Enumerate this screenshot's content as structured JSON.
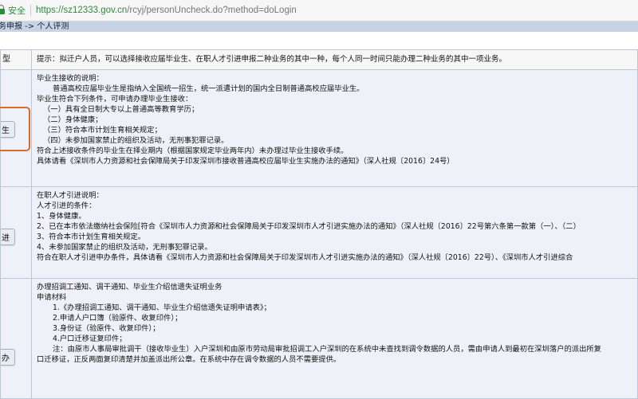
{
  "browser": {
    "secure_label": "安全",
    "url_host": "https://sz12333.gov.cn",
    "url_path": "/rcyj/personUncheck.do?method=doLogin"
  },
  "breadcrumb": "务申报 -> 个人评测",
  "header": {
    "type_label": "型",
    "tip": "提示：拟迁户人员，可以选择接收应届毕业生、在职人才引进申报二种业务的其中一种，每个人同一时间只能办理二种业务的其中一项业务。"
  },
  "rows": [
    {
      "button_label": "生",
      "lines": [
        "毕业生接收的说明：",
        "普通高校应届毕业生是指纳入全国统一招生，统一派遣计划的国内全日制普通高校应届毕业生。",
        "毕业生符合下列条件，可申请办理毕业生接收：",
        "（一）具有全日制大专以上普通高等教育学历；",
        "（二）身体健康；",
        "（三）符合本市计划生育相关规定；",
        "（四）未参加国家禁止的组织及活动，无刑事犯罪记录。",
        "符合上述接收条件的毕业生在择业期内（根据国家规定毕业两年内）未办理过毕业生接收手续。",
        "具体请看《深圳市人力资源和社会保障局关于印发深圳市接收普通高校应届毕业生实施办法的通知》（深人社规〔2016〕24号）"
      ]
    },
    {
      "button_label": "进",
      "lines": [
        "在职人才引进说明：",
        "人才引进的条件：",
        "1、身体健康。",
        "2、已在本市依法缴纳社会保险[符合《深圳市人力资源和社会保障局关于印发深圳市人才引进实施办法的通知》（深人社规〔2016〕22号第六条第一款第（一）、（二）",
        "3、符合本市计划生育相关规定。",
        "4、未参加国家禁止的组织及活动，无刑事犯罪记录。",
        "符合在职人才引进申办条件，具体请看《深圳市人力资源和社会保障局关于印发深圳市人才引进实施办法的通知》（深人社规〔2016〕22号）、《深圳市人才引进综合"
      ]
    },
    {
      "button_label": "办",
      "lines": [
        "办理招调工通知、调干通知、毕业生介绍信遗失证明业务",
        "申请材料",
        "1.《办理招调工通知、调干通知、毕业生介绍信遗失证明申请表》；",
        "2.申请人户口簿（验原件、收复印件）；",
        "3.身份证（验原件、收复印件）；",
        "4.户口迁移证复印件；",
        "注：由原市人事局审批调干（接收毕业生）入户深圳和由原市劳动局审批招调工入户深圳的在系统中未查找到调令数据的人员，需由申请人到最初在深圳落户的派出所复",
        "口迁移证，正反两面复印清楚并加盖派出所公章。在系统中存在调令数据的人员不需要提供。"
      ]
    }
  ]
}
